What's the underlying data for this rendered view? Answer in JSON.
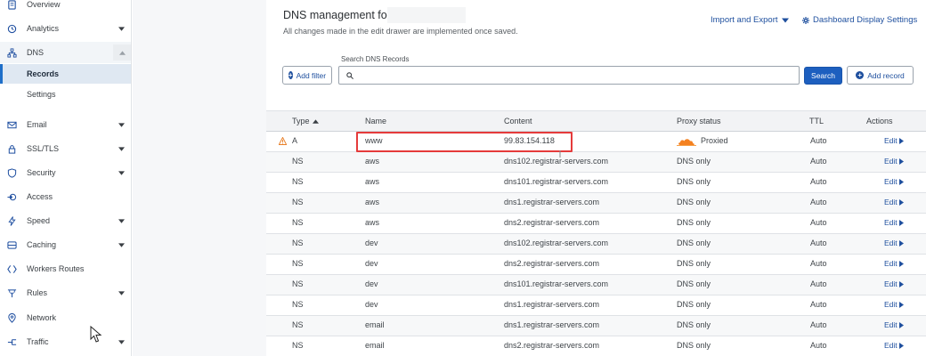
{
  "sidebar": {
    "items": [
      {
        "key": "overview",
        "label": "Overview",
        "icon": "document-icon",
        "caret": false
      },
      {
        "key": "analytics",
        "label": "Analytics",
        "icon": "clock-icon",
        "caret": true
      },
      {
        "key": "dns",
        "label": "DNS",
        "icon": "network-icon",
        "caret": true,
        "expanded": true
      },
      {
        "key": "email",
        "label": "Email",
        "icon": "envelope-icon",
        "caret": true
      },
      {
        "key": "ssl",
        "label": "SSL/TLS",
        "icon": "lock-icon",
        "caret": true
      },
      {
        "key": "security",
        "label": "Security",
        "icon": "shield-icon",
        "caret": true
      },
      {
        "key": "access",
        "label": "Access",
        "icon": "access-icon",
        "caret": false
      },
      {
        "key": "speed",
        "label": "Speed",
        "icon": "bolt-icon",
        "caret": true
      },
      {
        "key": "caching",
        "label": "Caching",
        "icon": "drive-icon",
        "caret": true
      },
      {
        "key": "workers",
        "label": "Workers Routes",
        "icon": "workers-icon",
        "caret": false
      },
      {
        "key": "rules",
        "label": "Rules",
        "icon": "filter-icon",
        "caret": true
      },
      {
        "key": "network",
        "label": "Network",
        "icon": "pin-icon",
        "caret": false
      },
      {
        "key": "traffic",
        "label": "Traffic",
        "icon": "traffic-icon",
        "caret": true
      }
    ],
    "dns_sub": [
      {
        "label": "Records",
        "active": true
      },
      {
        "label": "Settings",
        "active": false
      }
    ]
  },
  "main": {
    "title": "DNS management for",
    "subtitle": "All changes made in the edit drawer are implemented once saved.",
    "import_export_label": "Import and Export",
    "dashboard_settings_label": "Dashboard Display Settings",
    "search_label": "Search DNS Records",
    "search_value": "",
    "add_filter_label": "Add filter",
    "search_button_label": "Search",
    "add_record_label": "Add record"
  },
  "table": {
    "columns": {
      "type": "Type",
      "name": "Name",
      "content": "Content",
      "proxy": "Proxy status",
      "ttl": "TTL",
      "actions": "Actions"
    },
    "edit_label": "Edit",
    "rows": [
      {
        "type": "A",
        "name": "www",
        "content": "99.83.154.118",
        "proxy": "Proxied",
        "ttl": "Auto",
        "warning": true
      },
      {
        "type": "NS",
        "name": "aws",
        "content": "dns102.registrar-servers.com",
        "proxy": "DNS only",
        "ttl": "Auto"
      },
      {
        "type": "NS",
        "name": "aws",
        "content": "dns101.registrar-servers.com",
        "proxy": "DNS only",
        "ttl": "Auto"
      },
      {
        "type": "NS",
        "name": "aws",
        "content": "dns1.registrar-servers.com",
        "proxy": "DNS only",
        "ttl": "Auto"
      },
      {
        "type": "NS",
        "name": "aws",
        "content": "dns2.registrar-servers.com",
        "proxy": "DNS only",
        "ttl": "Auto"
      },
      {
        "type": "NS",
        "name": "dev",
        "content": "dns102.registrar-servers.com",
        "proxy": "DNS only",
        "ttl": "Auto"
      },
      {
        "type": "NS",
        "name": "dev",
        "content": "dns2.registrar-servers.com",
        "proxy": "DNS only",
        "ttl": "Auto"
      },
      {
        "type": "NS",
        "name": "dev",
        "content": "dns101.registrar-servers.com",
        "proxy": "DNS only",
        "ttl": "Auto"
      },
      {
        "type": "NS",
        "name": "dev",
        "content": "dns1.registrar-servers.com",
        "proxy": "DNS only",
        "ttl": "Auto"
      },
      {
        "type": "NS",
        "name": "email",
        "content": "dns1.registrar-servers.com",
        "proxy": "DNS only",
        "ttl": "Auto"
      },
      {
        "type": "NS",
        "name": "email",
        "content": "dns2.registrar-servers.com",
        "proxy": "DNS only",
        "ttl": "Auto"
      }
    ]
  },
  "colors": {
    "accent": "#1e4f9e",
    "primary_button": "#1d5fbf",
    "highlight": "#e53b3b",
    "proxied_cloud": "#f48120",
    "warning": "#e8802a"
  }
}
